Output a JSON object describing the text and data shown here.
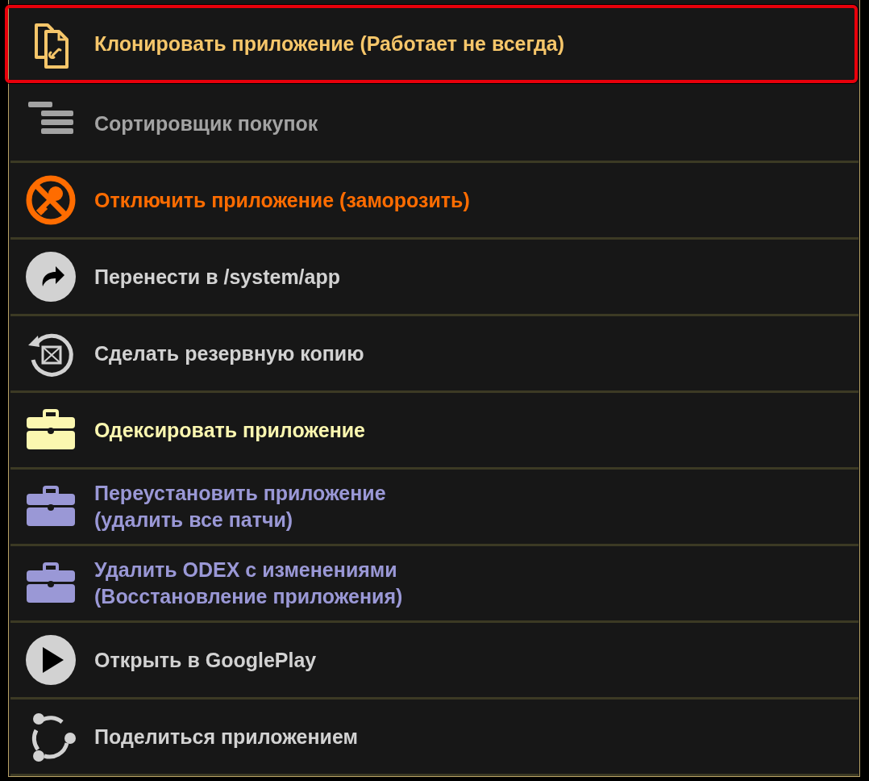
{
  "menu": {
    "items": [
      {
        "kind": "clone",
        "label": "Клонировать приложение (Работает не всегда)",
        "color": "#f6c66a",
        "selected": true
      },
      {
        "kind": "sorter",
        "label": "Сортировщик покупок",
        "color": "#a3a3a3",
        "selected": false
      },
      {
        "kind": "disable",
        "label": "Отключить приложение (заморозить)",
        "color": "#ff6c00",
        "selected": false
      },
      {
        "kind": "move",
        "label": "Перенести в /system/app",
        "color": "#d2d2d2",
        "selected": false
      },
      {
        "kind": "backup",
        "label": "Сделать резервную копию",
        "color": "#d2d2d2",
        "selected": false
      },
      {
        "kind": "briefcase",
        "label": "Одексировать приложение",
        "color": "#fbf7b0",
        "selected": false
      },
      {
        "kind": "briefcase",
        "label": "Переустановить приложение\n(удалить все патчи)",
        "color": "#9a98d6",
        "selected": false
      },
      {
        "kind": "briefcase",
        "label": "Удалить ODEX с изменениями\n(Восстановление приложения)",
        "color": "#9a98d6",
        "selected": false
      },
      {
        "kind": "play",
        "label": "Открыть в GooglePlay",
        "color": "#d2d2d2",
        "selected": false
      },
      {
        "kind": "share",
        "label": "Поделиться приложением",
        "color": "#d2d2d2",
        "selected": false
      }
    ]
  }
}
